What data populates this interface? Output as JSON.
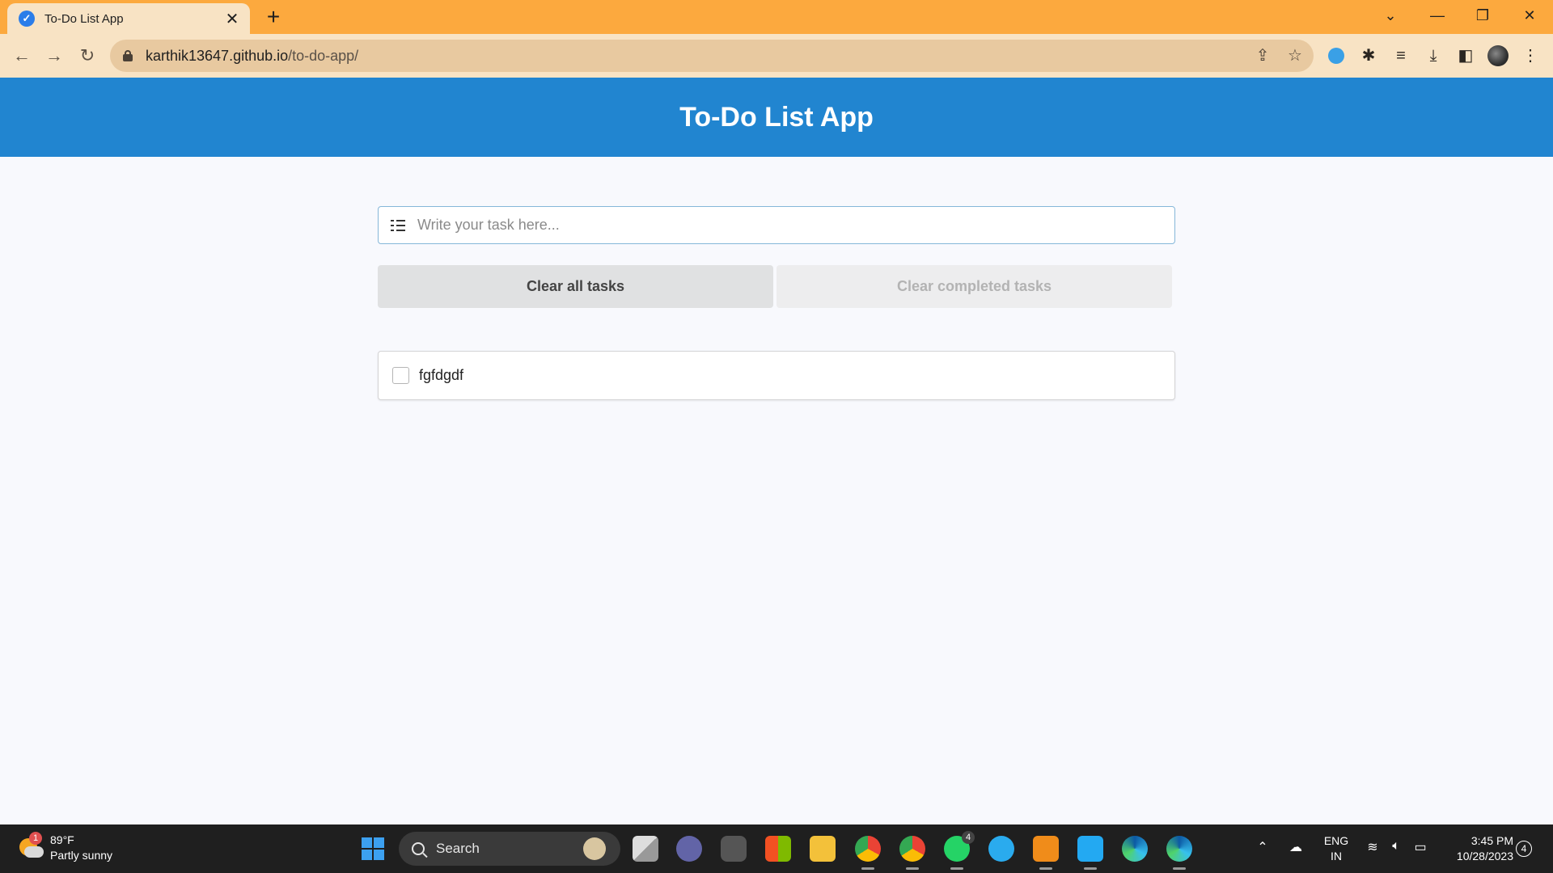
{
  "browser": {
    "tab_title": "To-Do List App",
    "tab_close": "✕",
    "new_tab": "+",
    "url_host": "karthik13647.github.io",
    "url_path": "/to-do-app/",
    "icons": [
      "back-icon",
      "forward-icon",
      "reload-icon",
      "lock-icon",
      "share-icon",
      "star-icon",
      "extension-icon",
      "puzzle-icon",
      "media-icon",
      "download-icon",
      "side-panel-icon",
      "profile-avatar",
      "menu-icon"
    ]
  },
  "window_controls": {
    "dropdown": "⌄",
    "minimize": "—",
    "restore": "❐",
    "close": "✕"
  },
  "app": {
    "title": "To-Do List App",
    "input_placeholder": "Write your task here...",
    "clear_all_label": "Clear all tasks",
    "clear_completed_label": "Clear completed tasks",
    "tasks": [
      {
        "text": "fgfdgdf",
        "completed": false
      }
    ]
  },
  "taskbar": {
    "weather_temp": "89°F",
    "weather_desc": "Partly sunny",
    "weather_badge": "1",
    "search_label": "Search",
    "lang_line1": "ENG",
    "lang_line2": "IN",
    "time": "3:45 PM",
    "date": "10/28/2023",
    "notification_count": "4",
    "whatsapp_badge": "4"
  },
  "colors": {
    "tabstrip": "#fca93e",
    "toolbar": "#f8e3c4",
    "header": "#2185d0",
    "page_bg": "#f8f9fd",
    "taskbar": "#1f1f1f"
  }
}
